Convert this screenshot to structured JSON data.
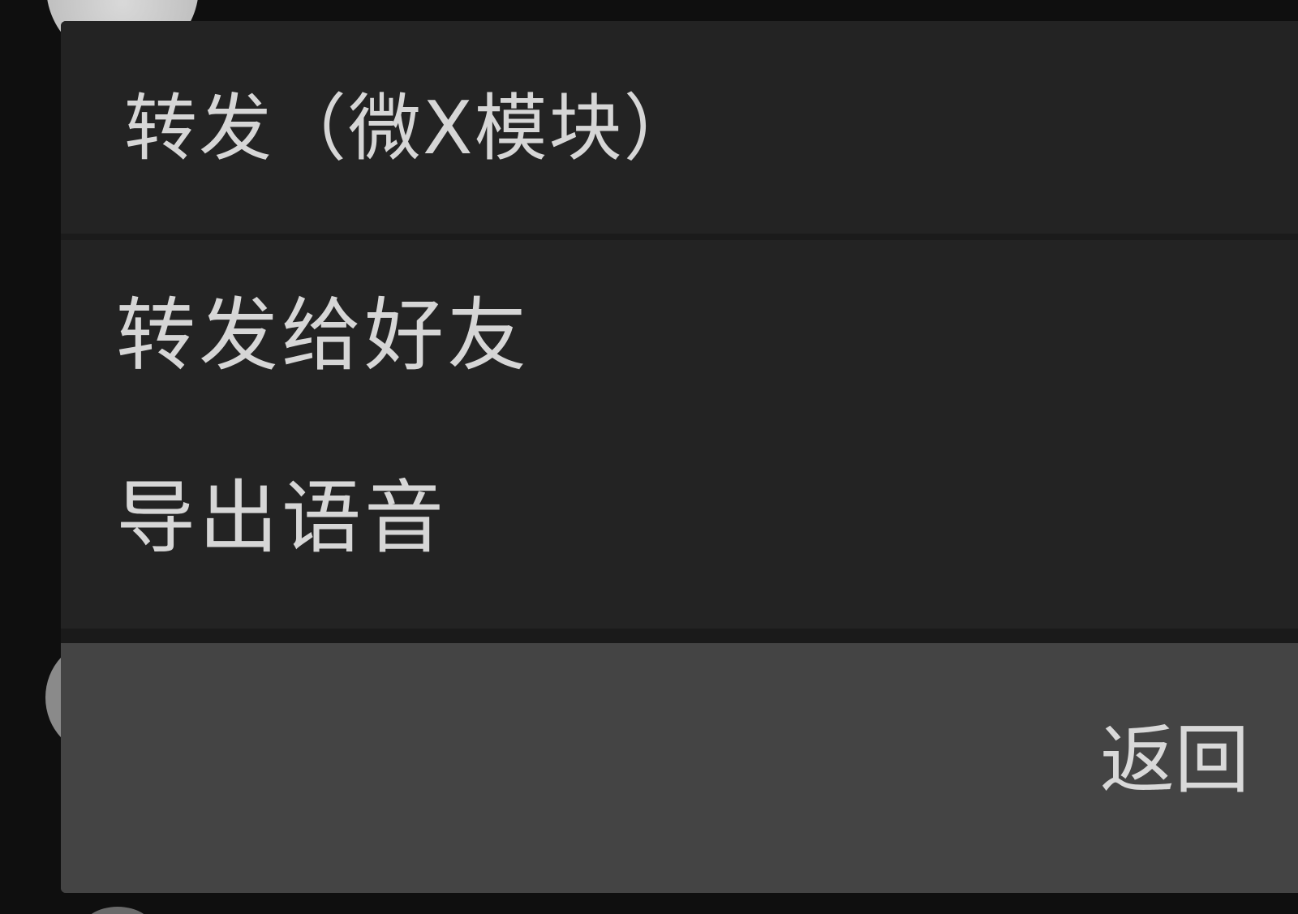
{
  "dialog": {
    "title": "转发（微X模块）",
    "items": [
      {
        "label": "转发给好友"
      },
      {
        "label": "导出语音"
      }
    ],
    "back_label": "返回"
  }
}
